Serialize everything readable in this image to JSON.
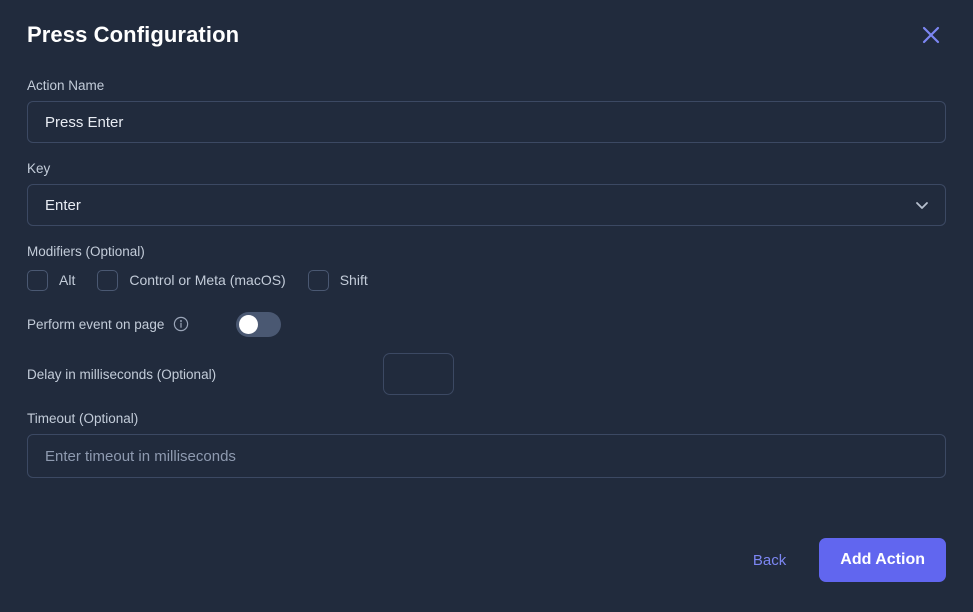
{
  "dialog": {
    "title": "Press Configuration",
    "close_icon": "close-icon"
  },
  "fields": {
    "action_name": {
      "label": "Action Name",
      "value": "Press Enter",
      "placeholder": ""
    },
    "key": {
      "label": "Key",
      "value": "Enter",
      "chevron_icon": "chevron-down-icon"
    },
    "modifiers": {
      "label": "Modifiers (Optional)",
      "options": [
        {
          "label": "Alt",
          "checked": false
        },
        {
          "label": "Control or Meta (macOS)",
          "checked": false
        },
        {
          "label": "Shift",
          "checked": false
        }
      ]
    },
    "perform_event": {
      "label": "Perform event on page",
      "info_icon": "info-icon",
      "enabled": false
    },
    "delay": {
      "label": "Delay in milliseconds (Optional)",
      "value": "",
      "placeholder": ""
    },
    "timeout": {
      "label": "Timeout (Optional)",
      "value": "",
      "placeholder": "Enter timeout in milliseconds"
    }
  },
  "footer": {
    "back_label": "Back",
    "submit_label": "Add Action"
  },
  "colors": {
    "background": "#212b3d",
    "accent": "#6166ef",
    "link": "#7c86f2",
    "border": "#3c4963",
    "text": "#c3ccd9",
    "toggle_track": "#4a5872"
  }
}
